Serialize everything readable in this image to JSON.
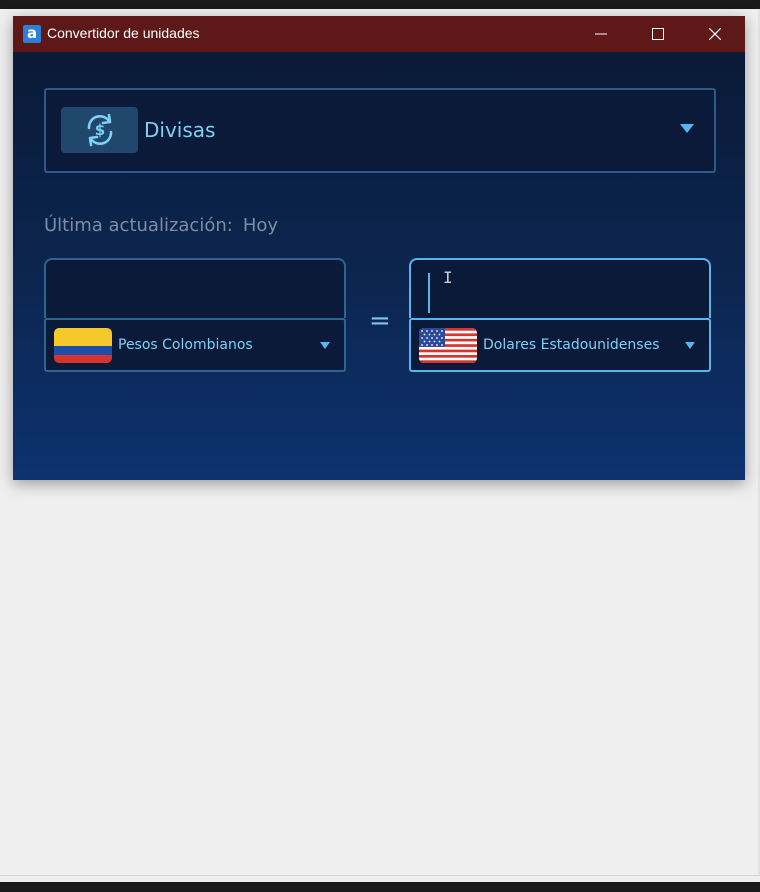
{
  "window": {
    "title": "Convertidor de unidades",
    "app_icon_letter": "a",
    "controls": [
      "minimize-icon",
      "maximize-icon",
      "close-icon"
    ]
  },
  "category": {
    "label": "Divisas",
    "icon": "currency-exchange-icon"
  },
  "last_update": {
    "label": "Última actualización:",
    "value": "Hoy"
  },
  "from": {
    "amount_value": "",
    "currency_name": "Pesos Colombianos",
    "flag": "colombia-flag"
  },
  "equals_symbol": "=",
  "to": {
    "amount_value": "",
    "currency_name": "Dolares Estadounidenses",
    "flag": "usa-flag"
  },
  "colors": {
    "titlebar": "#5e1818",
    "accent": "#7fd0f5",
    "focus_border": "#5ab3ec"
  }
}
